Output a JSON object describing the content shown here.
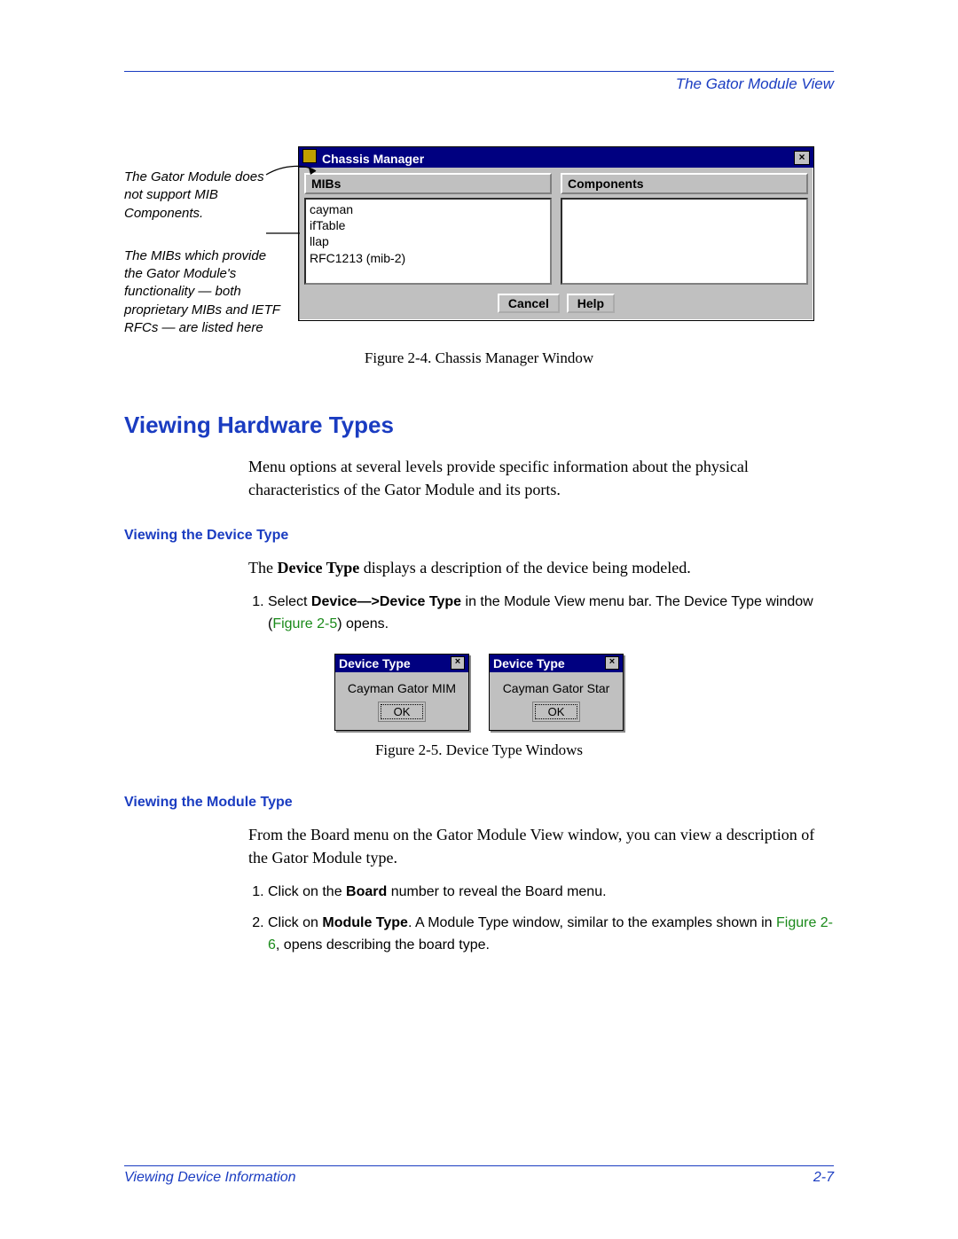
{
  "header": {
    "title": "The Gator Module View"
  },
  "side_notes": {
    "note1": "The Gator Module does not support MIB Components.",
    "note2": "The MIBs which provide the Gator Module's functionality — both proprietary MIBs and IETF RFCs — are listed here"
  },
  "chassis_mgr": {
    "title": "Chassis Manager",
    "mibs_label": "MIBs",
    "components_label": "Components",
    "mibs": [
      "cayman",
      "ifTable",
      "llap",
      "RFC1213 (mib-2)"
    ],
    "cancel": "Cancel",
    "help": "Help"
  },
  "fig1_caption": "Figure 2-4. Chassis Manager Window",
  "section_title": "Viewing Hardware Types",
  "section_intro": "Menu options at several levels provide specific information about the physical characteristics of the Gator Module and its ports.",
  "sub1_title": "Viewing the Device Type",
  "sub1_intro_a": "The ",
  "sub1_intro_b": "Device Type",
  "sub1_intro_c": " displays a description of the device being modeled.",
  "step1_a": "Select ",
  "step1_b": "Device—>Device Type",
  "step1_c": " in the Module View menu bar. The Device Type window (",
  "step1_d": "Figure 2-5",
  "step1_e": ") opens.",
  "devtype": {
    "title": "Device Type",
    "ok": "OK",
    "val1": "Cayman Gator MIM",
    "val2": "Cayman Gator Star"
  },
  "fig2_caption": "Figure 2-5. Device Type Windows",
  "sub2_title": "Viewing the Module Type",
  "sub2_intro": "From the Board menu on the Gator Module View window, you can view a description of the Gator Module type.",
  "s2_step1_a": "Click on the ",
  "s2_step1_b": "Board",
  "s2_step1_c": " number to reveal the Board menu.",
  "s2_step2_a": "Click on ",
  "s2_step2_b": "Module Type",
  "s2_step2_c": ". A Module Type window, similar to the examples shown in ",
  "s2_step2_d": "Figure 2-6",
  "s2_step2_e": ", opens describing the board type.",
  "footer": {
    "left": "Viewing Device Information",
    "right": "2-7"
  }
}
